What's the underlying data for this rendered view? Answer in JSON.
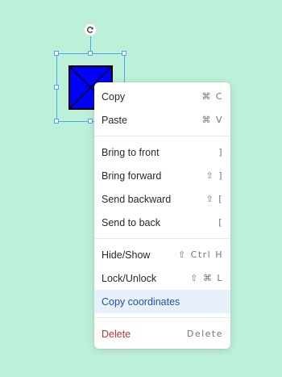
{
  "canvas": {
    "background": "#bdf0d8"
  },
  "shape": {
    "fill": "#0000ff",
    "stroke": "#000000"
  },
  "selection": {
    "color": "#4ea3f5"
  },
  "icons": {
    "rotate": "rotate-icon"
  },
  "menu": {
    "group1": [
      {
        "label": "Copy",
        "shortcut": "⌘ C"
      },
      {
        "label": "Paste",
        "shortcut": "⌘ V"
      }
    ],
    "group2": [
      {
        "label": "Bring to front",
        "shortcut": "]"
      },
      {
        "label": "Bring forward",
        "shortcut": "⇧ ]"
      },
      {
        "label": "Send backward",
        "shortcut": "⇧ ["
      },
      {
        "label": "Send to back",
        "shortcut": "["
      }
    ],
    "group3": [
      {
        "label": "Hide/Show",
        "shortcut": "⇧ Ctrl H"
      },
      {
        "label": "Lock/Unlock",
        "shortcut": "⇧ ⌘ L"
      },
      {
        "label": "Copy coordinates",
        "shortcut": ""
      }
    ],
    "group4": [
      {
        "label": "Delete",
        "shortcut": "Delete"
      }
    ],
    "highlight_color": "#e8f1fb",
    "danger_color": "#c0352a"
  }
}
